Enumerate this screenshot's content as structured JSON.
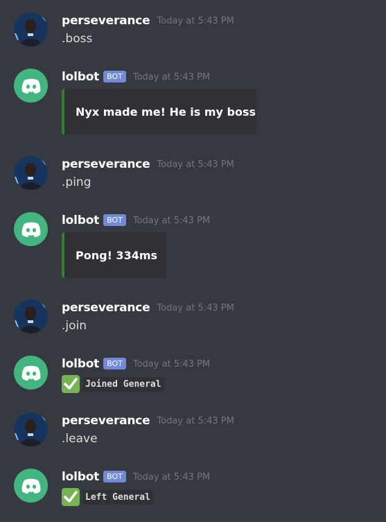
{
  "messages": [
    {
      "author": "perseverance",
      "timestamp": "Today at 5:43 PM",
      "text": ".boss"
    },
    {
      "author": "lolbot",
      "bot_tag": "BOT",
      "timestamp": "Today at 5:43 PM",
      "embed_text": "Nyx made me! He is my boss"
    },
    {
      "author": "perseverance",
      "timestamp": "Today at 5:43 PM",
      "text": ".ping"
    },
    {
      "author": "lolbot",
      "bot_tag": "BOT",
      "timestamp": "Today at 5:43 PM",
      "embed_text": "Pong! 334ms"
    },
    {
      "author": "perseverance",
      "timestamp": "Today at 5:43 PM",
      "text": ".join"
    },
    {
      "author": "lolbot",
      "bot_tag": "BOT",
      "timestamp": "Today at 5:43 PM",
      "code_text": "Joined General"
    },
    {
      "author": "perseverance",
      "timestamp": "Today at 5:43 PM",
      "text": ".leave"
    },
    {
      "author": "lolbot",
      "bot_tag": "BOT",
      "timestamp": "Today at 5:43 PM",
      "code_text": "Left General"
    }
  ],
  "colors": {
    "background": "#36393f",
    "embed_bg": "#2f3136",
    "embed_border": "#3a7d2f",
    "bot_tag": "#7289da",
    "bot_avatar": "#43b581",
    "check": "#77b255"
  },
  "icons": {
    "bot_avatar": "discord-logo-icon",
    "check": "check-mark-icon"
  }
}
